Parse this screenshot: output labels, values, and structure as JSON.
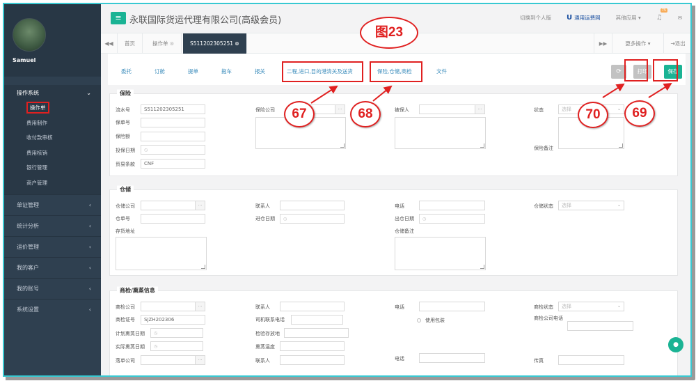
{
  "figure_label": "图23",
  "sidebar": {
    "username": "Samuel",
    "operations_group": "操作系统",
    "sub_items": [
      "操作单",
      "费用制作",
      "收付款审核",
      "费用核销",
      "银行管理",
      "商户管理"
    ],
    "groups": [
      "单证管理",
      "统计分析",
      "运价管理",
      "我的客户",
      "我的账号",
      "系统设置"
    ]
  },
  "header": {
    "company": "永联国际货运代理有限公司(高级会员)",
    "switch_personal": "切换到个人版",
    "brand": "通用运费网",
    "other_apps": "其他应用",
    "notification_count": "75"
  },
  "tabs": {
    "home": "首页",
    "order": "操作单",
    "current": "S511202305251",
    "more_ops": "更多操作",
    "exit": "退出"
  },
  "subtabs": [
    "委托",
    "订舱",
    "提单",
    "拖车",
    "报关",
    "二程,进口,目的港清关及送货",
    "保险,仓储,商检",
    "文件"
  ],
  "buttons": {
    "print": "打印",
    "save": "保存"
  },
  "callouts": {
    "c67": "67",
    "c68": "68",
    "c69": "69",
    "c70": "70"
  },
  "insurance": {
    "title": "保险",
    "serial_label": "流水号",
    "serial_value": "S511202305251",
    "policy_no_label": "保单号",
    "amount_label": "保险额",
    "date_label": "投保日期",
    "trade_terms_label": "贸易条款",
    "trade_terms_value": "CNF",
    "company_label": "保险公司",
    "insured_label": "被保人",
    "status_label": "状态",
    "status_placeholder": "选择",
    "remark_label": "保险备注"
  },
  "warehouse": {
    "title": "仓储",
    "company_label": "仓储公司",
    "contact_label": "联系人",
    "phone_label": "电话",
    "status_label": "仓储状态",
    "status_placeholder": "选择",
    "order_no_label": "仓单号",
    "in_date_label": "进仓日期",
    "out_date_label": "出仓日期",
    "address_label": "存货地址",
    "remark_label": "仓储备注"
  },
  "inspection": {
    "title": "商检/熏蒸信息",
    "company_label": "商检公司",
    "contact_label": "联系人",
    "phone_label": "电话",
    "status_label": "商检状态",
    "status_placeholder": "选择",
    "cert_label": "商检证号",
    "cert_value": "SJZH202306",
    "driver_phone_label": "司机联系电话",
    "use_package": "使用包装",
    "company_phone_label": "商检公司电话",
    "plan_date_label": "计划熏蒸日期",
    "storage_label": "检验存放地",
    "actual_date_label": "实际熏蒸日期",
    "temp_label": "熏蒸温度",
    "drop_company_label": "落单公司",
    "contact2_label": "联系人",
    "phone2_label": "电话",
    "fax_label": "传真"
  }
}
